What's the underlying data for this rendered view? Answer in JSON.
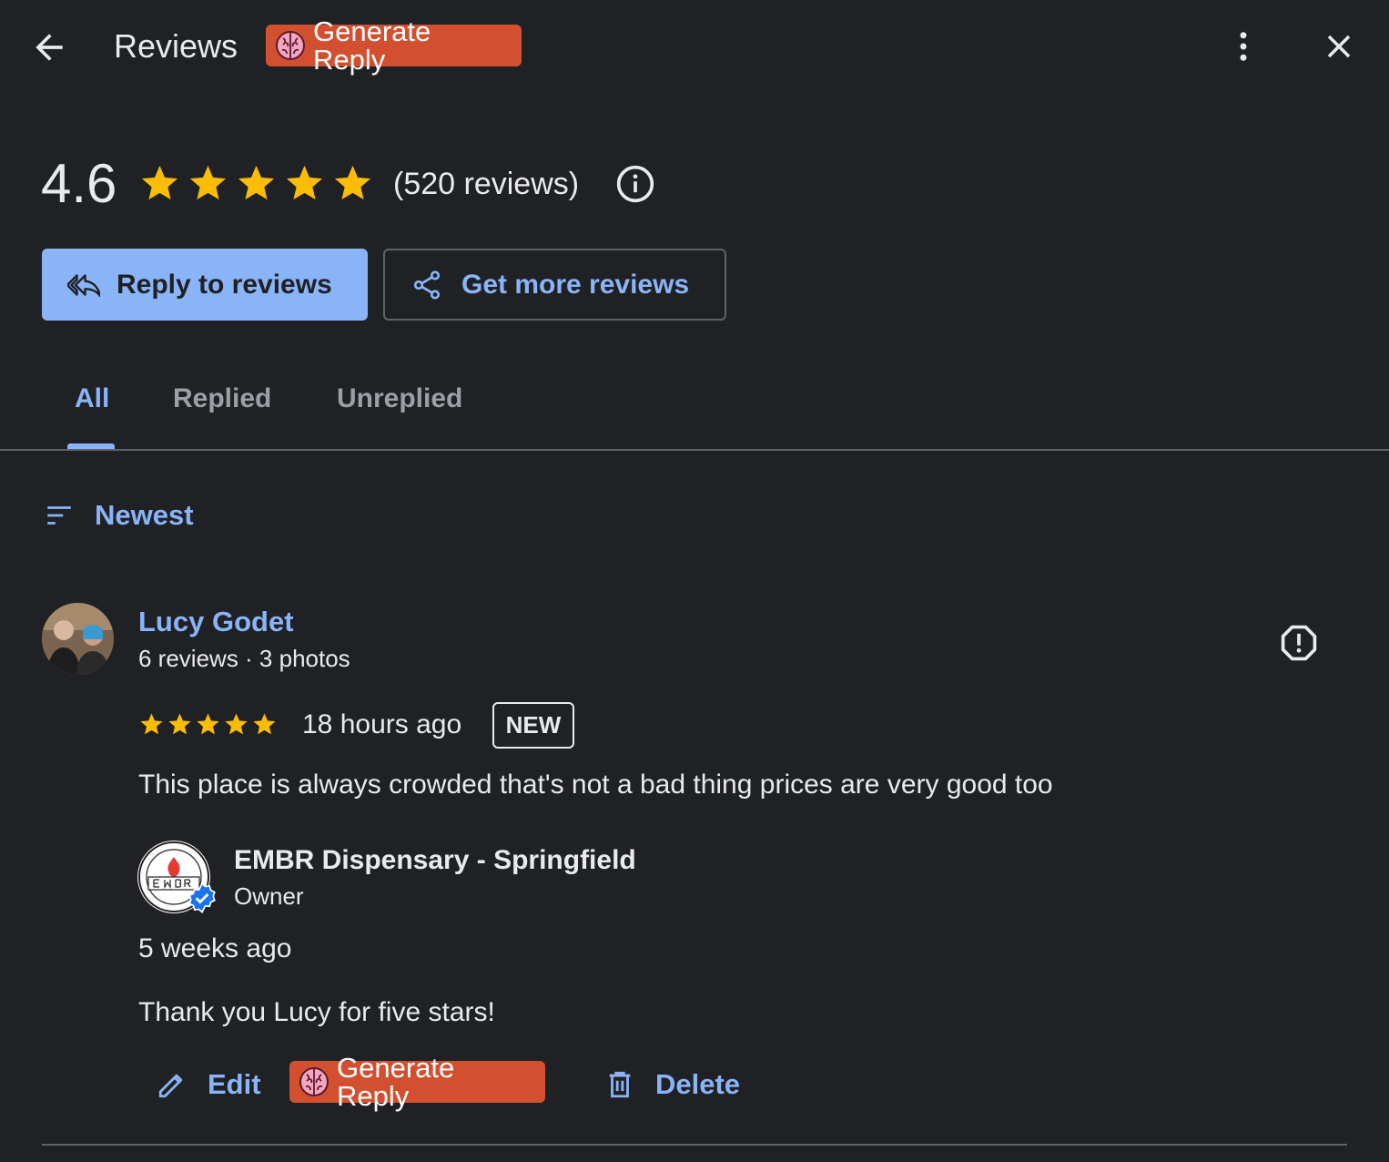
{
  "header": {
    "title": "Reviews",
    "generate_reply_label": "Generate Reply",
    "back_icon": "arrow-back-icon",
    "more_icon": "more-vert-icon",
    "close_icon": "close-icon"
  },
  "summary": {
    "rating": "4.6",
    "stars": 5,
    "review_count": "(520 reviews)",
    "info_icon": "info-icon"
  },
  "actions": {
    "reply_label": "Reply to reviews",
    "get_more_label": "Get more reviews"
  },
  "tabs": [
    {
      "label": "All",
      "selected": true
    },
    {
      "label": "Replied",
      "selected": false
    },
    {
      "label": "Unreplied",
      "selected": false
    }
  ],
  "sort": {
    "label": "Newest"
  },
  "review": {
    "author": "Lucy Godet",
    "meta": "6 reviews · 3 photos",
    "stars": 5,
    "time": "18 hours ago",
    "badge": "NEW",
    "text": "This place is always crowded that's not a bad thing prices are very good too",
    "owner": {
      "name": "EMBR Dispensary - Springfield",
      "role": "Owner",
      "time": "5 weeks ago",
      "text": "Thank you Lucy for five stars!"
    },
    "actions": {
      "edit_label": "Edit",
      "generate_reply_label": "Generate Reply",
      "delete_label": "Delete"
    }
  },
  "colors": {
    "background": "#202124",
    "accent": "#8ab4f8",
    "star": "#fbbc04",
    "generate_button": "#d2502f"
  }
}
